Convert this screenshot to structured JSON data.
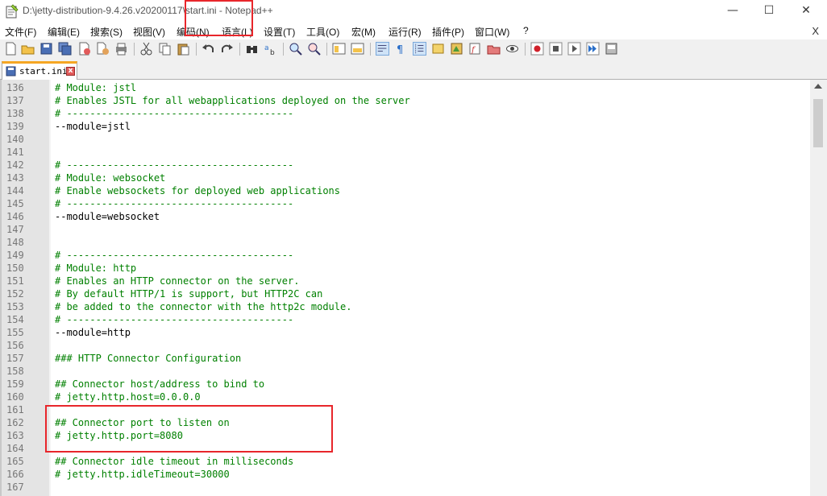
{
  "window": {
    "title": "D:\\jetty-distribution-9.4.26.v20200117\\start.ini - Notepad++",
    "minimize": "—",
    "maximize": "☐",
    "close": "✕"
  },
  "menu": {
    "items": [
      "文件(F)",
      "编辑(E)",
      "搜索(S)",
      "视图(V)",
      "编码(N)",
      "语言(L)",
      "设置(T)",
      "工具(O)",
      "宏(M)",
      "运行(R)",
      "插件(P)",
      "窗口(W)",
      "?"
    ],
    "close_label": "X"
  },
  "toolbar": {
    "icons": [
      "new-file-icon",
      "open-file-icon",
      "save-icon",
      "save-all-icon",
      "close-icon",
      "close-all-icon",
      "print-icon",
      "cut-icon",
      "copy-icon",
      "paste-icon",
      "undo-icon",
      "redo-icon",
      "find-icon",
      "replace-icon",
      "zoom-in-icon",
      "zoom-out-icon",
      "sync-vertical-icon",
      "sync-horizontal-icon",
      "word-wrap-icon",
      "show-all-chars-icon",
      "indent-guide-icon",
      "udl-icon",
      "doc-map-icon",
      "function-list-icon",
      "folder-workspace-icon",
      "monitor-icon",
      "record-macro-icon",
      "stop-macro-icon",
      "play-macro-icon",
      "run-macro-multiple-icon",
      "save-macro-icon"
    ]
  },
  "tab": {
    "label": "start.ini",
    "close": "x"
  },
  "editor": {
    "lines": [
      {
        "n": "136",
        "text": "# Module: jstl",
        "kind": "comment"
      },
      {
        "n": "137",
        "text": "# Enables JSTL for all webapplications deployed on the server",
        "kind": "comment"
      },
      {
        "n": "138",
        "text": "# ---------------------------------------",
        "kind": "comment"
      },
      {
        "n": "139",
        "text": "--module=jstl",
        "kind": "plain"
      },
      {
        "n": "140",
        "text": "",
        "kind": "plain"
      },
      {
        "n": "141",
        "text": "",
        "kind": "plain"
      },
      {
        "n": "142",
        "text": "# ---------------------------------------",
        "kind": "comment"
      },
      {
        "n": "143",
        "text": "# Module: websocket",
        "kind": "comment"
      },
      {
        "n": "144",
        "text": "# Enable websockets for deployed web applications",
        "kind": "comment"
      },
      {
        "n": "145",
        "text": "# ---------------------------------------",
        "kind": "comment"
      },
      {
        "n": "146",
        "text": "--module=websocket",
        "kind": "plain"
      },
      {
        "n": "147",
        "text": "",
        "kind": "plain"
      },
      {
        "n": "148",
        "text": "",
        "kind": "plain"
      },
      {
        "n": "149",
        "text": "# ---------------------------------------",
        "kind": "comment"
      },
      {
        "n": "150",
        "text": "# Module: http",
        "kind": "comment"
      },
      {
        "n": "151",
        "text": "# Enables an HTTP connector on the server.",
        "kind": "comment"
      },
      {
        "n": "152",
        "text": "# By default HTTP/1 is support, but HTTP2C can",
        "kind": "comment"
      },
      {
        "n": "153",
        "text": "# be added to the connector with the http2c module.",
        "kind": "comment"
      },
      {
        "n": "154",
        "text": "# ---------------------------------------",
        "kind": "comment"
      },
      {
        "n": "155",
        "text": "--module=http",
        "kind": "plain"
      },
      {
        "n": "156",
        "text": "",
        "kind": "plain"
      },
      {
        "n": "157",
        "text": "### HTTP Connector Configuration",
        "kind": "comment"
      },
      {
        "n": "158",
        "text": "",
        "kind": "plain"
      },
      {
        "n": "159",
        "text": "## Connector host/address to bind to",
        "kind": "comment"
      },
      {
        "n": "160",
        "text": "# jetty.http.host=0.0.0.0",
        "kind": "comment"
      },
      {
        "n": "161",
        "text": "",
        "kind": "plain"
      },
      {
        "n": "162",
        "text": "## Connector port to listen on",
        "kind": "comment"
      },
      {
        "n": "163",
        "text": "# jetty.http.port=8080",
        "kind": "comment"
      },
      {
        "n": "164",
        "text": "",
        "kind": "plain"
      },
      {
        "n": "165",
        "text": "## Connector idle timeout in milliseconds",
        "kind": "comment"
      },
      {
        "n": "166",
        "text": "# jetty.http.idleTimeout=30000",
        "kind": "comment"
      },
      {
        "n": "167",
        "text": "",
        "kind": "plain"
      }
    ]
  },
  "colors": {
    "comment": "#008000",
    "highlight_box": "#e8262b",
    "tab_accent": "#f5a623"
  }
}
